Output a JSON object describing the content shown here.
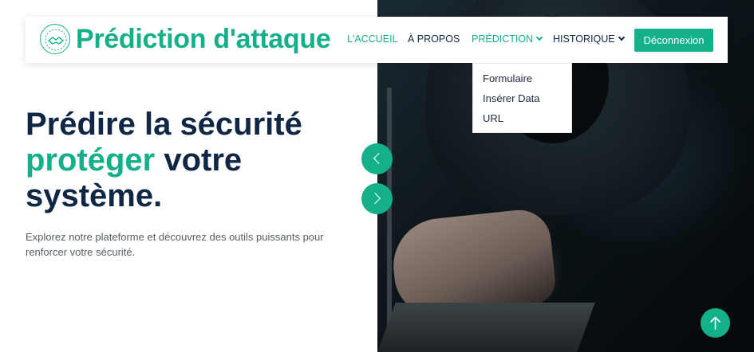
{
  "brand": {
    "title": "Prédiction d'attaque",
    "logo_icon": "shield-handshake-icon"
  },
  "nav": {
    "items": [
      {
        "label": "L'ACCUEIL",
        "active": true
      },
      {
        "label": "À PROPOS",
        "active": false
      },
      {
        "label": "PRÉDICTION",
        "active": true,
        "dropdown": true
      },
      {
        "label": "HISTORIQUE",
        "active": false,
        "dropdown": true
      }
    ],
    "logout_label": "Déconnexion"
  },
  "dropdown": {
    "items": [
      "Formulaire",
      "Insérer Data",
      "URL"
    ]
  },
  "hero": {
    "line1": "Prédire la sécurité",
    "accent": "protéger",
    "line2_rest": " votre",
    "line3": "système.",
    "description": "Explorez notre plateforme et découvrez des outils puissants pour renforcer votre sécurité."
  },
  "carousel": {
    "prev_icon": "chevron-left-icon",
    "next_icon": "chevron-right-icon"
  },
  "back_to_top_icon": "arrow-up-icon",
  "colors": {
    "accent": "#14b08a",
    "heading": "#0f2744",
    "text": "#555e66"
  }
}
